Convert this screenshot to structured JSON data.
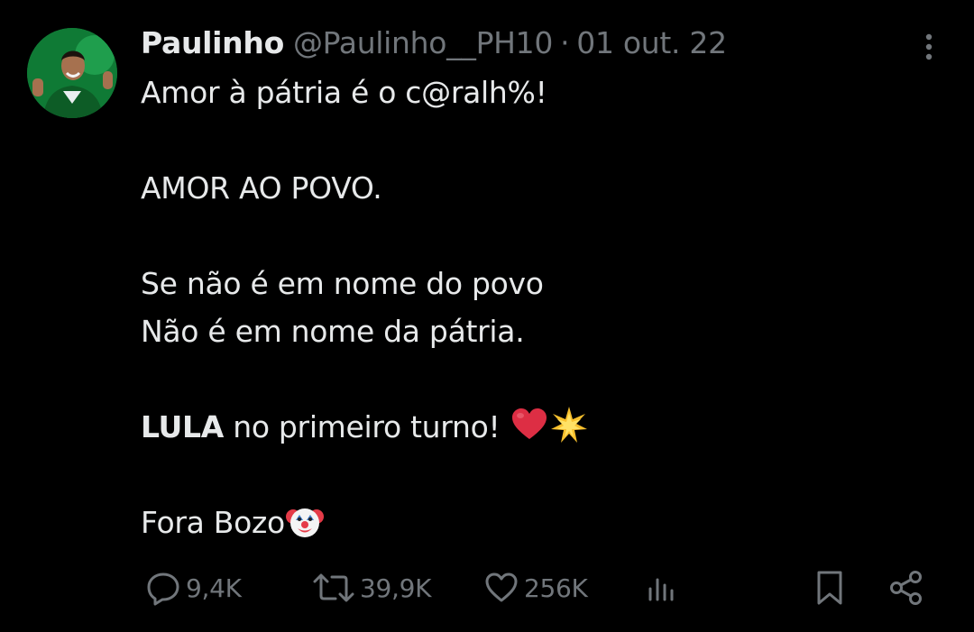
{
  "author": {
    "name": "Paulinho",
    "handle": "@Paulinho__PH10",
    "separator": "·",
    "date": "01 out. 22"
  },
  "tweet": {
    "line1": "Amor à pátria é o c@ralh%!",
    "line2": "AMOR AO POVO.",
    "line3": "Se não é em nome do povo",
    "line4": "Não é em nome da pátria.",
    "line5_bold": "LULA",
    "line5_rest": " no primeiro turno! ",
    "line6": "Fora Bozo",
    "emojis": [
      "red-heart",
      "glowing-star",
      "clown-face"
    ]
  },
  "actions": {
    "replies": "9,4K",
    "retweets": "39,9K",
    "likes": "256K"
  },
  "colors": {
    "background": "#000000",
    "text": "#e7e9ea",
    "muted": "#71767b"
  }
}
